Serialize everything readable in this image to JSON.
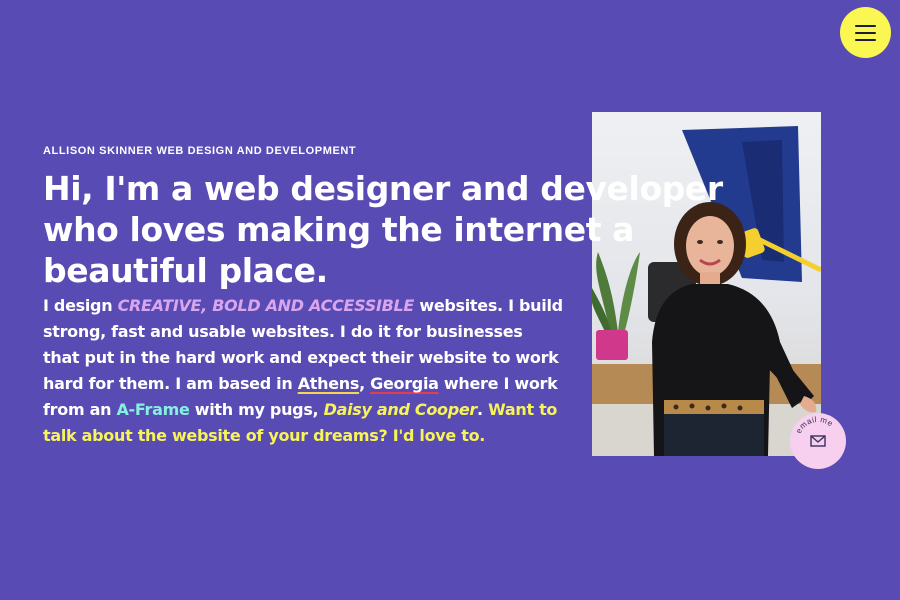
{
  "colors": {
    "background": "#594bb4",
    "text": "#ffffff",
    "accent_lavender": "#d9a6ee",
    "accent_mint": "#86f0e0",
    "accent_yellow": "#f7f457",
    "menu_yellow": "#faf753",
    "badge_pink": "#f6d0ee",
    "underline_red": "#e63c50",
    "underline_yellow": "#f5d94a"
  },
  "header": {
    "menu_icon": "hamburger-icon"
  },
  "hero": {
    "eyebrow": "ALLISON SKINNER WEB DESIGN AND DEVELOPMENT",
    "headline": "Hi, I'm a web designer and developer who loves making the internet a beautiful place.",
    "intro": {
      "t1": "I design ",
      "accent": "CREATIVE, BOLD AND ACCESSIBLE",
      "t2": " websites. I build strong, fast and usable websites. I do it for businesses that put in the hard work and expect their website to work hard for them. I am based in ",
      "athens": "Athens",
      "comma": ", ",
      "georgia": "Georgia",
      "t3": " where I work from an ",
      "aframe": "A-Frame",
      "t4": " with my pugs, ",
      "pugs": "Daisy and Cooper",
      "t5": ". ",
      "cta": "Want to talk about the website of your dreams? I'd love to."
    }
  },
  "email_badge": {
    "label": "email me",
    "icon": "envelope-icon"
  }
}
